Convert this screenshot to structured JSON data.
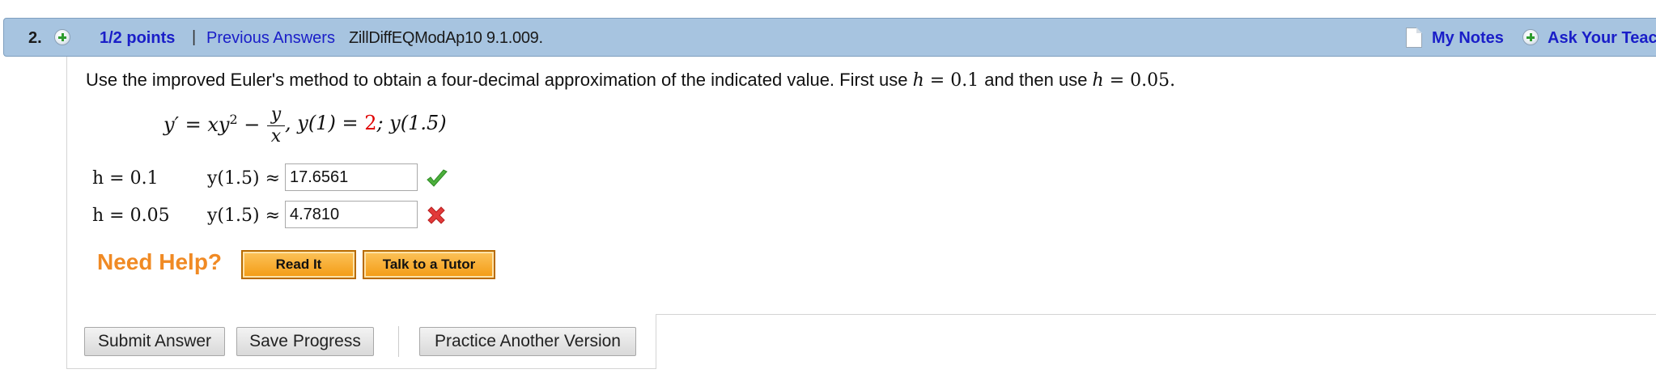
{
  "header": {
    "question_number": "2.",
    "points": "1/2 points",
    "separator": "|",
    "previous_answers": "Previous Answers",
    "problem_code": "ZillDiffEQModAp10 9.1.009.",
    "my_notes": "My Notes",
    "ask_teacher": "Ask Your Teac"
  },
  "question": {
    "instruction_pre": "Use the improved Euler's method to obtain a four-decimal approximation of the indicated value. First use ",
    "instruction_h1": "h",
    "instruction_eq1": " = 0.1 ",
    "instruction_mid": " and then use ",
    "instruction_h2": "h",
    "instruction_eq2": " = 0.05.",
    "equation": {
      "lhs": "y′ = xy",
      "exponent": "2",
      "minus": " −",
      "frac_num": "y",
      "frac_den": "x",
      "after_frac": ", y(1) = ",
      "initial_value": "2",
      "target": ";  y(1.5)"
    }
  },
  "answers": [
    {
      "h_label": "h = 0.1",
      "y_label": "y(1.5) ≈",
      "value": "17.6561",
      "status": "correct"
    },
    {
      "h_label": "h = 0.05",
      "y_label": "y(1.5) ≈",
      "value": "4.7810",
      "status": "incorrect"
    }
  ],
  "help": {
    "label": "Need Help?",
    "read_it": "Read It",
    "talk_to_tutor": "Talk to a Tutor"
  },
  "buttons": {
    "submit": "Submit Answer",
    "save": "Save Progress",
    "practice": "Practice Another Version"
  },
  "colors": {
    "header_bg": "#a7c4e0",
    "link": "#1a1ec8",
    "help_orange": "#f08a24",
    "correct_green": "#4caf3c",
    "incorrect_red": "#e23a3a",
    "initial_value_red": "#e00000"
  },
  "icons": {
    "points_icon": "plus-circle-icon",
    "notes_icon": "note-icon",
    "ask_icon": "plus-circle-icon",
    "correct_icon": "checkmark-icon",
    "incorrect_icon": "x-mark-icon"
  }
}
